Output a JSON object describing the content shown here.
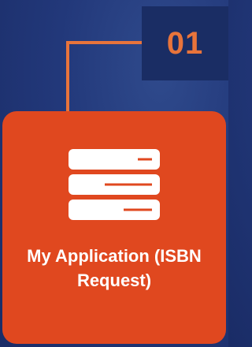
{
  "step": {
    "number": "01"
  },
  "card": {
    "icon": "server-icon",
    "title_line1": "My Application (ISBN",
    "title_line2": "Request)"
  },
  "colors": {
    "background": "#22387a",
    "accent_orange": "#e8743b",
    "card": "#e0481f",
    "step_box": "#1a2d64",
    "text": "#ffffff"
  }
}
